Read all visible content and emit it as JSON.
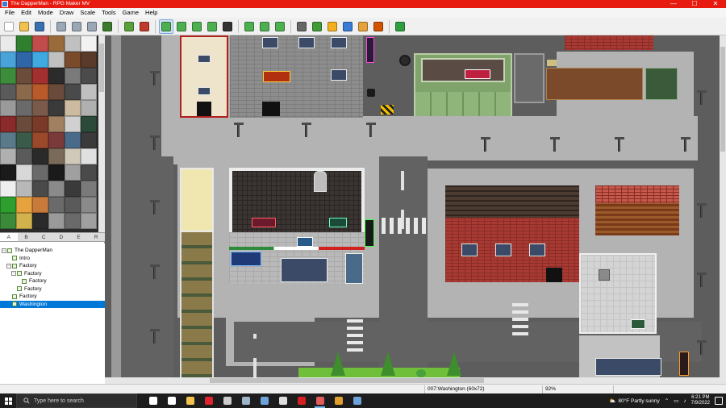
{
  "window": {
    "title": "The DapperMan - RPG Maker MV",
    "controls": [
      "—",
      "☐",
      "✕"
    ]
  },
  "menu": [
    "File",
    "Edit",
    "Mode",
    "Draw",
    "Scale",
    "Tools",
    "Game",
    "Help"
  ],
  "toolbar": {
    "buttons": [
      {
        "name": "new-project-icon",
        "color": "#ffffff"
      },
      {
        "name": "open-project-icon",
        "color": "#f2c14e"
      },
      {
        "name": "save-project-icon",
        "color": "#3a6fb0"
      },
      {
        "name": "cut-icon",
        "color": "#9aa7b5"
      },
      {
        "name": "copy-icon",
        "color": "#9aa7b5"
      },
      {
        "name": "paste-icon",
        "color": "#9aa7b5"
      },
      {
        "name": "undo-icon",
        "color": "#3a7b2e"
      },
      {
        "name": "map-mode-icon",
        "color": "#5aa03a"
      },
      {
        "name": "event-mode-icon",
        "color": "#c0392b"
      },
      {
        "name": "pencil-icon",
        "color": "#4caf50"
      },
      {
        "name": "rectangle-icon",
        "color": "#4caf50"
      },
      {
        "name": "ellipse-icon",
        "color": "#4caf50"
      },
      {
        "name": "fill-icon",
        "color": "#4caf50"
      },
      {
        "name": "shadow-pen-icon",
        "color": "#333333"
      },
      {
        "name": "zoom-in-icon",
        "color": "#4caf50"
      },
      {
        "name": "zoom-out-icon",
        "color": "#4caf50"
      },
      {
        "name": "actual-size-icon",
        "color": "#4caf50"
      },
      {
        "name": "database-icon",
        "color": "#666666"
      },
      {
        "name": "plugin-manager-icon",
        "color": "#3f9c35"
      },
      {
        "name": "sound-test-icon",
        "color": "#f2b01e"
      },
      {
        "name": "event-searcher-icon",
        "color": "#3a7bd5"
      },
      {
        "name": "resource-manager-icon",
        "color": "#e6a23c"
      },
      {
        "name": "character-generator-icon",
        "color": "#d35400"
      },
      {
        "name": "playtest-icon",
        "color": "#2e9e3e"
      }
    ]
  },
  "tileset": {
    "tabs": [
      "A",
      "B",
      "C",
      "D",
      "E",
      "R"
    ],
    "selected_tab": "A",
    "tile_colors": [
      "#eaeaea",
      "#2f7f2f",
      "#c24b4b",
      "#9a6b3a",
      "#c0c0c0",
      "#f2f2f2",
      "#4aa3d8",
      "#2f66a8",
      "#3fa9e0",
      "#c0c0c0",
      "#7a4b2b",
      "#5a3a2a",
      "#3c8c3c",
      "#6b4b3a",
      "#a33030",
      "#2b2b2b",
      "#7a7a7a",
      "#4b4b4b",
      "#5a5a5a",
      "#8a6a4a",
      "#b85a2a",
      "#6a4a3a",
      "#4a4a4a",
      "#c0c0c0",
      "#9a9a9a",
      "#6a6a6a",
      "#7a5a4a",
      "#3a3a3a",
      "#ccbba0",
      "#b0b0b0",
      "#8b2a2a",
      "#6a4a3a",
      "#7a3a2a",
      "#a08060",
      "#d0d0d0",
      "#2c4a3a",
      "#5a7a8a",
      "#3a5a4a",
      "#9a4a2a",
      "#7a3a3a",
      "#4a6a8a",
      "#3a3a3a",
      "#b0b0b0",
      "#5a5a5a",
      "#2a2a2a",
      "#7a6a5a",
      "#d0c8b8",
      "#e0e0e0",
      "#1a1a1a",
      "#d8d8d8",
      "#6a6a6a",
      "#1a1a1a",
      "#a0a0a0",
      "#4a4a4a",
      "#eeeeee",
      "#b8b8b8",
      "#4a4a4a",
      "#8a8a8a",
      "#3a3a3a",
      "#7a7a7a",
      "#2e9e2e",
      "#e6a23c",
      "#c87a3a",
      "#6a6a6a",
      "#5a5a5a",
      "#8a8a8a",
      "#3a8a3a",
      "#d2b24c",
      "#2a2a2a",
      "#9a9a9a",
      "#6a6a6a",
      "#a0a0a0"
    ]
  },
  "map_tree": [
    {
      "label": "The DapperMan",
      "depth": 0,
      "expander": "−",
      "selected": false
    },
    {
      "label": "Intro",
      "depth": 1,
      "expander": "",
      "selected": false
    },
    {
      "label": "Factory",
      "depth": 1,
      "expander": "−",
      "selected": false
    },
    {
      "label": "Factory",
      "depth": 2,
      "expander": "−",
      "selected": false
    },
    {
      "label": "Factory",
      "depth": 3,
      "expander": "",
      "selected": false
    },
    {
      "label": "Factory",
      "depth": 2,
      "expander": "",
      "selected": false
    },
    {
      "label": "Factory",
      "depth": 1,
      "expander": "",
      "selected": false
    },
    {
      "label": "Washington",
      "depth": 1,
      "expander": "",
      "selected": true
    }
  ],
  "status": {
    "map_info": "007:Washington (60x72)",
    "zoom": "92%"
  },
  "taskbar": {
    "search_placeholder": "Type here to search",
    "apps": [
      {
        "name": "task-view-icon",
        "color": "#ffffff",
        "active": false
      },
      {
        "name": "cortana-icon",
        "color": "#ffffff",
        "active": false
      },
      {
        "name": "file-explorer-icon",
        "color": "#f2c14e",
        "active": false
      },
      {
        "name": "opera-icon",
        "color": "#e0242f",
        "active": false
      },
      {
        "name": "settings-icon",
        "color": "#cccccc",
        "active": false
      },
      {
        "name": "steam-chat-icon",
        "color": "#9fb4c8",
        "active": false
      },
      {
        "name": "steam-icon",
        "color": "#6ea2d8",
        "active": false
      },
      {
        "name": "unity-icon",
        "color": "#dddddd",
        "active": false
      },
      {
        "name": "media-player-icon",
        "color": "#d62020",
        "active": false
      },
      {
        "name": "rpg-maker-icon",
        "color": "#e25c5c",
        "active": true
      },
      {
        "name": "shield-app-icon",
        "color": "#e0a030",
        "active": false
      },
      {
        "name": "steam-app-icon",
        "color": "#6ea2d8",
        "active": false
      }
    ],
    "weather": "80°F  Partly sunny",
    "time": "6:21 PM",
    "date": "7/9/2022"
  }
}
